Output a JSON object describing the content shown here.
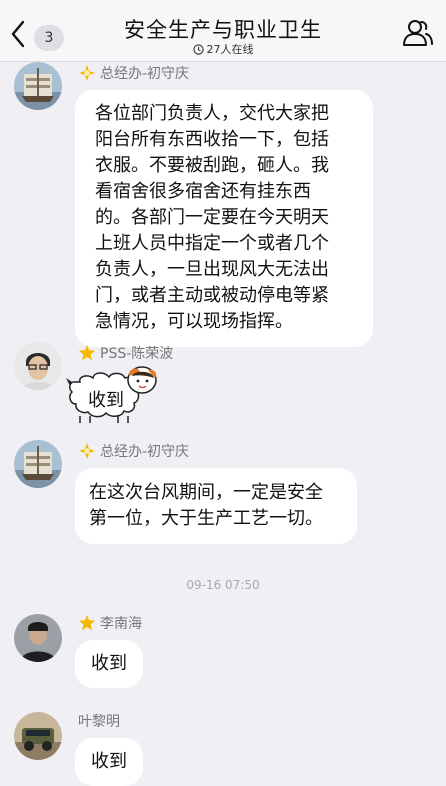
{
  "header": {
    "back_count": "3",
    "title": "安全生产与职业卫生",
    "online": "27人在线"
  },
  "messages": [
    {
      "sender": "总经办-初守庆",
      "lines": [
        "各位部门负责人，交代大家把",
        "阳台所有东西收拾一下，包括",
        "衣服。不要被刮跑，砸人。我",
        "看宿舍很多宿舍还有挂东西",
        "的。各部门一定要在今天明天",
        "上班人员中指定一个或者几个",
        "负责人，一旦出现风大无法出",
        "门，或者主动或被动停电等紧",
        "急情况，可以现场指挥。"
      ]
    },
    {
      "sender": "PSS-陈荣波",
      "text": "收到"
    },
    {
      "sender": "总经办-初守庆",
      "lines": [
        "在这次台风期间，一定是安全",
        "第一位，大于生产工艺一切。"
      ]
    },
    {
      "sender": "李南海",
      "text": "收到"
    },
    {
      "sender": "叶黎明",
      "text": "收到"
    }
  ],
  "timestamp": "09-16 07:50",
  "colors": {
    "star": "#f5b800",
    "background": "#efeff4",
    "bubble": "#ffffff"
  }
}
